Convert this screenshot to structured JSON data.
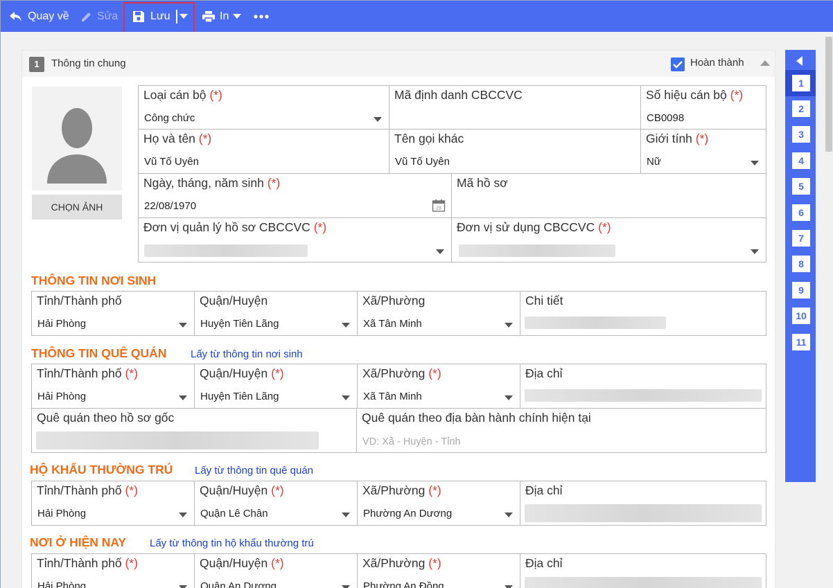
{
  "toolbar": {
    "back": "Quay về",
    "edit": "Sửa",
    "save": "Lưu",
    "print": "In"
  },
  "section": {
    "number": "1",
    "title": "Thông tin chung",
    "complete_label": "Hoàn thành"
  },
  "photo": {
    "button": "CHỌN ẢNH"
  },
  "general": {
    "loai_can_bo": {
      "label": "Loại cán bộ",
      "value": "Công chức"
    },
    "ma_dinh_danh": {
      "label": "Mã định danh CBCCVC",
      "value": ""
    },
    "so_hieu": {
      "label": "Số hiệu cán bộ",
      "value": "CB0098"
    },
    "ho_ten": {
      "label": "Họ và tên",
      "value": "Vũ Tố Uyên"
    },
    "ten_goi_khac": {
      "label": "Tên gọi khác",
      "value": "Vũ Tố Uyên"
    },
    "gioi_tinh": {
      "label": "Giới tính",
      "value": "Nữ"
    },
    "ngay_sinh": {
      "label": "Ngày, tháng, năm sinh",
      "value": "22/08/1970"
    },
    "ma_ho_so": {
      "label": "Mã hồ sơ",
      "value": ""
    },
    "don_vi_ql": {
      "label": "Đơn vị quản lý hồ sơ CBCCVC"
    },
    "don_vi_sd": {
      "label": "Đơn vị sử dụng CBCCVC"
    }
  },
  "required_mark": "(*)",
  "noi_sinh": {
    "title": "THÔNG TIN NƠI SINH",
    "tinh": {
      "label": "Tỉnh/Thành phố",
      "value": "Hải Phòng"
    },
    "huyen": {
      "label": "Quận/Huyện",
      "value": "Huyện Tiên Lãng"
    },
    "xa": {
      "label": "Xã/Phường",
      "value": "Xã Tân Minh"
    },
    "chi_tiet": {
      "label": "Chi tiết"
    }
  },
  "que_quan": {
    "title": "THÔNG TIN QUÊ QUÁN",
    "link": "Lấy từ thông tin nơi sinh",
    "tinh": {
      "label": "Tỉnh/Thành phố",
      "value": "Hải Phòng"
    },
    "huyen": {
      "label": "Quận/Huyện",
      "value": "Huyện Tiên Lãng"
    },
    "xa": {
      "label": "Xã/Phường",
      "value": "Xã Tân Minh"
    },
    "dia_chi": {
      "label": "Địa chỉ"
    },
    "goc": {
      "label": "Quê quán theo hồ sơ gốc"
    },
    "hien_tai": {
      "label": "Quê quán theo địa bàn hành chính hiện tại",
      "placeholder": "VD: Xã - Huyện - Tỉnh"
    }
  },
  "ho_khau": {
    "title": "HỘ KHẨU THƯỜNG TRÚ",
    "link": "Lấy từ thông tin quê quán",
    "tinh": {
      "label": "Tỉnh/Thành phố",
      "value": "Hải Phòng"
    },
    "huyen": {
      "label": "Quận/Huyện",
      "value": "Quận Lê Chân"
    },
    "xa": {
      "label": "Xã/Phường",
      "value": "Phường An Dương"
    },
    "dia_chi": {
      "label": "Địa chỉ"
    }
  },
  "noi_o": {
    "title": "NƠI Ở HIỆN NAY",
    "link": "Lấy từ thông tin hộ khẩu thường trú",
    "tinh": {
      "label": "Tỉnh/Thành phố",
      "value": "Hải Phòng"
    },
    "huyen": {
      "label": "Quận/Huyện",
      "value": "Quận An Dương"
    },
    "xa": {
      "label": "Xã/Phường",
      "value": "Phường An Đồng"
    },
    "dia_chi": {
      "label": "Địa chỉ"
    }
  },
  "sidenav": [
    "1",
    "2",
    "3",
    "4",
    "5",
    "6",
    "7",
    "8",
    "9",
    "10",
    "11"
  ],
  "colors": {
    "toolbar": "#4a6cf0",
    "section_title": "#f26c17",
    "required": "#e53935",
    "link": "#1a3fd8",
    "highlight": "#e0314b"
  }
}
